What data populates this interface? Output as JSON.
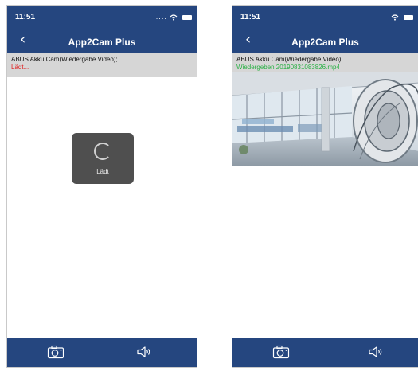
{
  "screen_left": {
    "status_time": "11:51",
    "status_icons": "....",
    "nav_title": "App2Cam Plus",
    "info_line1": "ABUS Akku Cam(Wiedergabe Video);",
    "info_line2": "Lädt...",
    "loading_label": "Lädt"
  },
  "screen_right": {
    "status_time": "11:51",
    "status_icons": "",
    "nav_title": "App2Cam Plus",
    "info_line1": "ABUS Akku Cam(Wiedergabe Video);",
    "info_line2": "Wiedergeben 20190831083826.mp4"
  },
  "colors": {
    "nav_bar": "#25467f",
    "info_bar": "#d6d6d6",
    "loading_text": "#e02020",
    "playing_text": "#27b043"
  },
  "icons": {
    "back": "chevron-left-icon",
    "camera": "camera-icon",
    "speaker": "speaker-icon",
    "wifi": "wifi-icon",
    "battery": "battery-icon"
  }
}
